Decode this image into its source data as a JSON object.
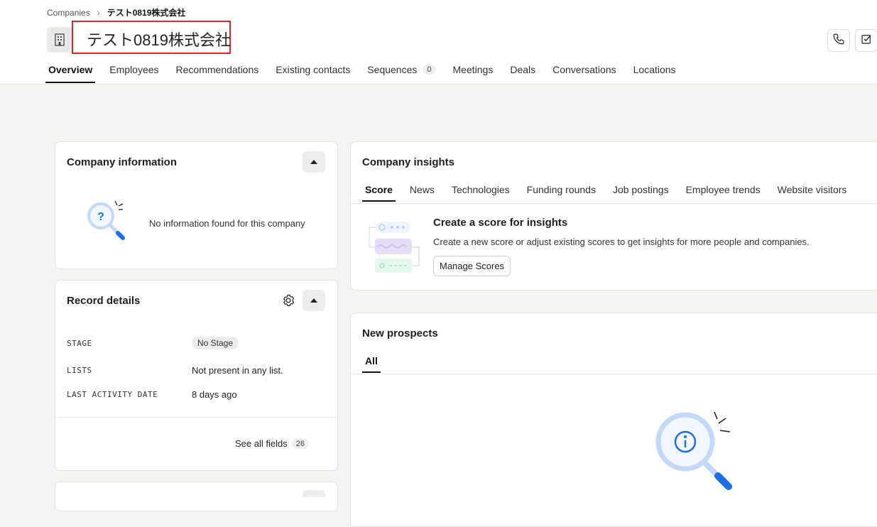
{
  "breadcrumb": {
    "parent": "Companies",
    "current": "テスト0819株式会社"
  },
  "company": {
    "name": "テスト0819株式会社"
  },
  "tabs": [
    {
      "label": "Overview"
    },
    {
      "label": "Employees"
    },
    {
      "label": "Recommendations"
    },
    {
      "label": "Existing contacts"
    },
    {
      "label": "Sequences",
      "count": "0"
    },
    {
      "label": "Meetings"
    },
    {
      "label": "Deals"
    },
    {
      "label": "Conversations"
    },
    {
      "label": "Locations"
    }
  ],
  "company_info": {
    "title": "Company information",
    "empty_text": "No information found for this company"
  },
  "record_details": {
    "title": "Record details",
    "fields": [
      {
        "label": "STAGE",
        "value": "No Stage"
      },
      {
        "label": "LISTS",
        "value": "Not present in any list."
      },
      {
        "label": "LAST ACTIVITY DATE",
        "value": "8 days ago"
      }
    ],
    "see_all_label": "See all fields",
    "see_all_count": "26"
  },
  "insights": {
    "title": "Company insights",
    "tabs": [
      "Score",
      "News",
      "Technologies",
      "Funding rounds",
      "Job postings",
      "Employee trends",
      "Website visitors"
    ],
    "heading": "Create a score for insights",
    "description": "Create a new score or adjust existing scores to get insights for more people and companies.",
    "button": "Manage Scores"
  },
  "prospects": {
    "title": "New prospects",
    "tab": "All"
  },
  "colors": {
    "highlight": "#e0262a",
    "accent_blue": "#1a6fe8"
  },
  "icons": [
    "building-icon",
    "phone-icon",
    "task-check-icon",
    "gear-icon",
    "magnifier-question-icon",
    "magnifier-info-icon"
  ]
}
